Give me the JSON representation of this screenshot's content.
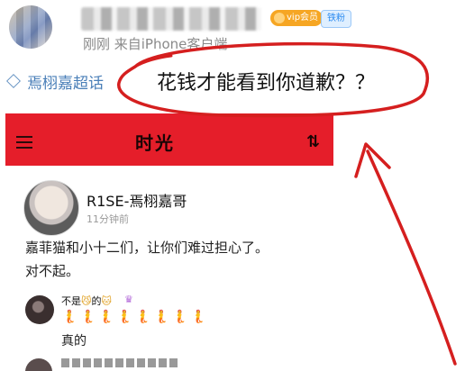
{
  "post": {
    "username_placeholder": "",
    "vip_label": "vip会员",
    "iron_label": "铁粉",
    "meta": "刚刚  来自iPhone客户端"
  },
  "topic": {
    "label": "焉栩嘉超话",
    "text": "花钱才能看到你道歉？？"
  },
  "banner": {
    "title": "时光",
    "sort_glyph": "⇅",
    "color": "#e51e2a"
  },
  "inner_post": {
    "name": "R1SE-焉栩嘉哥",
    "time": "11分钟前",
    "line1": "嘉菲猫和小十二们，让你们难过担心了。",
    "line2": "对不起。"
  },
  "comment": {
    "user": "不是",
    "user_suffix": "的",
    "emoji_row": [
      "🧜",
      "🧜",
      "🧜",
      "🧜",
      "🧜",
      "🧜",
      "🧜",
      "🧜"
    ],
    "text": "真的"
  },
  "annotation_color": "#d51f1f"
}
